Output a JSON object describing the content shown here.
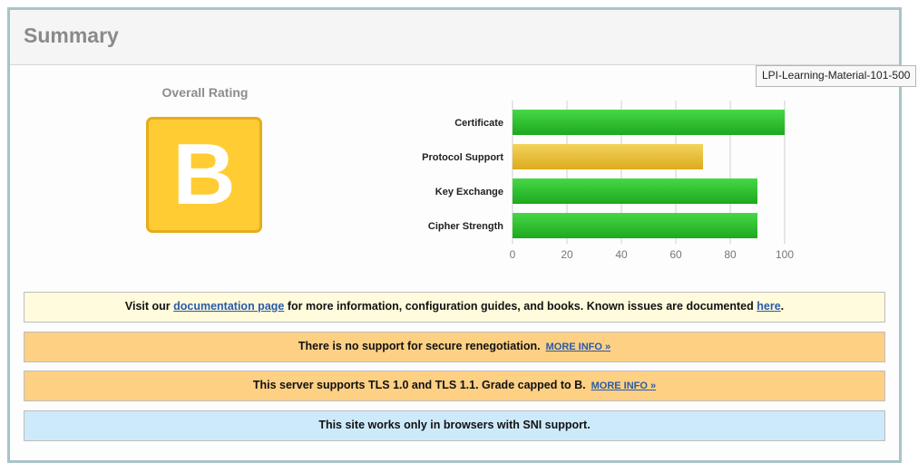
{
  "header": {
    "title": "Summary"
  },
  "overall": {
    "label": "Overall Rating",
    "grade": "B"
  },
  "tooltip": {
    "text": "LPI-Learning-Material-101-500"
  },
  "chart_data": {
    "type": "bar",
    "orientation": "horizontal",
    "categories": [
      "Certificate",
      "Protocol Support",
      "Key Exchange",
      "Cipher Strength"
    ],
    "values": [
      100,
      70,
      90,
      90
    ],
    "bar_colors": [
      "#22b522",
      "#e6b828",
      "#22b522",
      "#22b522"
    ],
    "xlim": [
      0,
      100
    ],
    "ticks": [
      0,
      20,
      40,
      60,
      80,
      100
    ],
    "grid": true
  },
  "notices": {
    "doc": {
      "prefix": "Visit our ",
      "link1": "documentation page",
      "middle": " for more information, configuration guides, and books. Known issues are documented ",
      "link2": "here",
      "suffix": "."
    },
    "renegotiation": {
      "text": "There is no support for secure renegotiation.",
      "link": "MORE INFO »"
    },
    "tls": {
      "text": "This server supports TLS 1.0 and TLS 1.1. Grade capped to B.",
      "link": "MORE INFO »"
    },
    "sni": {
      "text": "This site works only in browsers with SNI support."
    }
  },
  "colors": {
    "grade_fill": "#ffcc33",
    "green_bar": "#22b522",
    "yellow_bar": "#e6b828",
    "notice_yellow": "#fffbdc",
    "notice_orange": "#fdd084",
    "notice_blue": "#cdeafb"
  }
}
